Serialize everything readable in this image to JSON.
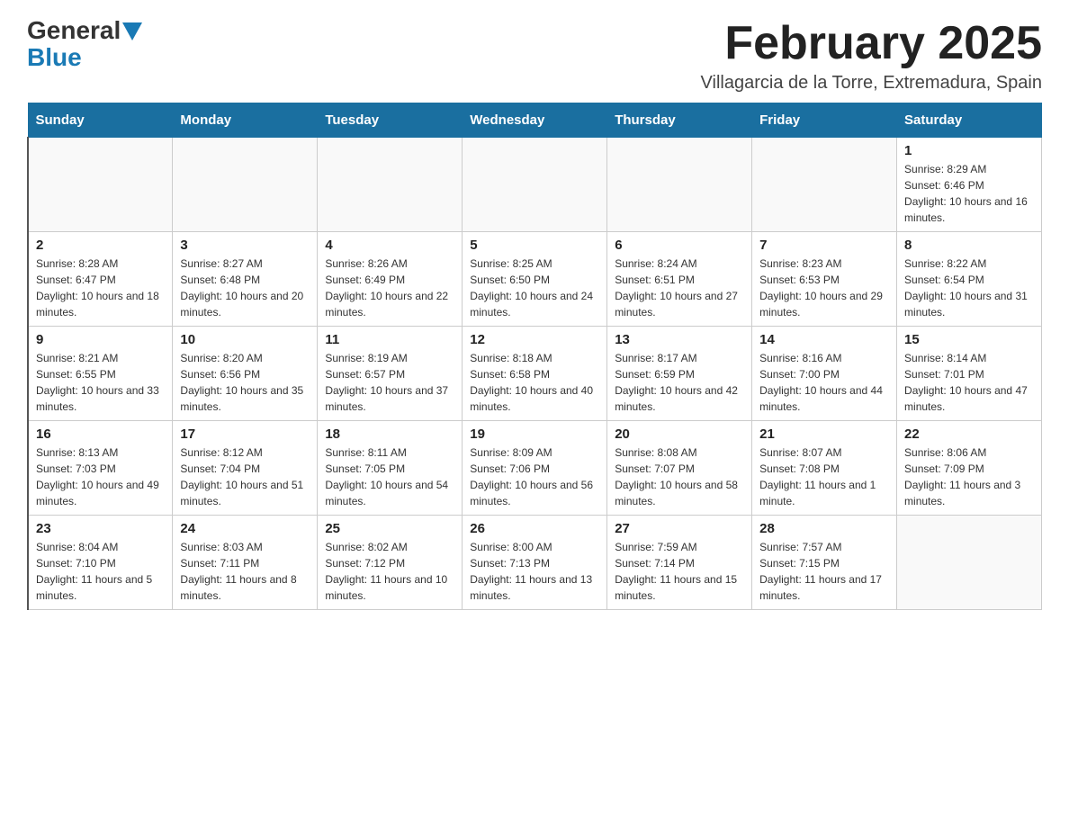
{
  "header": {
    "logo_general": "General",
    "logo_blue": "Blue",
    "month_title": "February 2025",
    "location": "Villagarcia de la Torre, Extremadura, Spain"
  },
  "weekdays": [
    "Sunday",
    "Monday",
    "Tuesday",
    "Wednesday",
    "Thursday",
    "Friday",
    "Saturday"
  ],
  "weeks": [
    [
      {
        "day": "",
        "info": ""
      },
      {
        "day": "",
        "info": ""
      },
      {
        "day": "",
        "info": ""
      },
      {
        "day": "",
        "info": ""
      },
      {
        "day": "",
        "info": ""
      },
      {
        "day": "",
        "info": ""
      },
      {
        "day": "1",
        "info": "Sunrise: 8:29 AM\nSunset: 6:46 PM\nDaylight: 10 hours and 16 minutes."
      }
    ],
    [
      {
        "day": "2",
        "info": "Sunrise: 8:28 AM\nSunset: 6:47 PM\nDaylight: 10 hours and 18 minutes."
      },
      {
        "day": "3",
        "info": "Sunrise: 8:27 AM\nSunset: 6:48 PM\nDaylight: 10 hours and 20 minutes."
      },
      {
        "day": "4",
        "info": "Sunrise: 8:26 AM\nSunset: 6:49 PM\nDaylight: 10 hours and 22 minutes."
      },
      {
        "day": "5",
        "info": "Sunrise: 8:25 AM\nSunset: 6:50 PM\nDaylight: 10 hours and 24 minutes."
      },
      {
        "day": "6",
        "info": "Sunrise: 8:24 AM\nSunset: 6:51 PM\nDaylight: 10 hours and 27 minutes."
      },
      {
        "day": "7",
        "info": "Sunrise: 8:23 AM\nSunset: 6:53 PM\nDaylight: 10 hours and 29 minutes."
      },
      {
        "day": "8",
        "info": "Sunrise: 8:22 AM\nSunset: 6:54 PM\nDaylight: 10 hours and 31 minutes."
      }
    ],
    [
      {
        "day": "9",
        "info": "Sunrise: 8:21 AM\nSunset: 6:55 PM\nDaylight: 10 hours and 33 minutes."
      },
      {
        "day": "10",
        "info": "Sunrise: 8:20 AM\nSunset: 6:56 PM\nDaylight: 10 hours and 35 minutes."
      },
      {
        "day": "11",
        "info": "Sunrise: 8:19 AM\nSunset: 6:57 PM\nDaylight: 10 hours and 37 minutes."
      },
      {
        "day": "12",
        "info": "Sunrise: 8:18 AM\nSunset: 6:58 PM\nDaylight: 10 hours and 40 minutes."
      },
      {
        "day": "13",
        "info": "Sunrise: 8:17 AM\nSunset: 6:59 PM\nDaylight: 10 hours and 42 minutes."
      },
      {
        "day": "14",
        "info": "Sunrise: 8:16 AM\nSunset: 7:00 PM\nDaylight: 10 hours and 44 minutes."
      },
      {
        "day": "15",
        "info": "Sunrise: 8:14 AM\nSunset: 7:01 PM\nDaylight: 10 hours and 47 minutes."
      }
    ],
    [
      {
        "day": "16",
        "info": "Sunrise: 8:13 AM\nSunset: 7:03 PM\nDaylight: 10 hours and 49 minutes."
      },
      {
        "day": "17",
        "info": "Sunrise: 8:12 AM\nSunset: 7:04 PM\nDaylight: 10 hours and 51 minutes."
      },
      {
        "day": "18",
        "info": "Sunrise: 8:11 AM\nSunset: 7:05 PM\nDaylight: 10 hours and 54 minutes."
      },
      {
        "day": "19",
        "info": "Sunrise: 8:09 AM\nSunset: 7:06 PM\nDaylight: 10 hours and 56 minutes."
      },
      {
        "day": "20",
        "info": "Sunrise: 8:08 AM\nSunset: 7:07 PM\nDaylight: 10 hours and 58 minutes."
      },
      {
        "day": "21",
        "info": "Sunrise: 8:07 AM\nSunset: 7:08 PM\nDaylight: 11 hours and 1 minute."
      },
      {
        "day": "22",
        "info": "Sunrise: 8:06 AM\nSunset: 7:09 PM\nDaylight: 11 hours and 3 minutes."
      }
    ],
    [
      {
        "day": "23",
        "info": "Sunrise: 8:04 AM\nSunset: 7:10 PM\nDaylight: 11 hours and 5 minutes."
      },
      {
        "day": "24",
        "info": "Sunrise: 8:03 AM\nSunset: 7:11 PM\nDaylight: 11 hours and 8 minutes."
      },
      {
        "day": "25",
        "info": "Sunrise: 8:02 AM\nSunset: 7:12 PM\nDaylight: 11 hours and 10 minutes."
      },
      {
        "day": "26",
        "info": "Sunrise: 8:00 AM\nSunset: 7:13 PM\nDaylight: 11 hours and 13 minutes."
      },
      {
        "day": "27",
        "info": "Sunrise: 7:59 AM\nSunset: 7:14 PM\nDaylight: 11 hours and 15 minutes."
      },
      {
        "day": "28",
        "info": "Sunrise: 7:57 AM\nSunset: 7:15 PM\nDaylight: 11 hours and 17 minutes."
      },
      {
        "day": "",
        "info": ""
      }
    ]
  ]
}
